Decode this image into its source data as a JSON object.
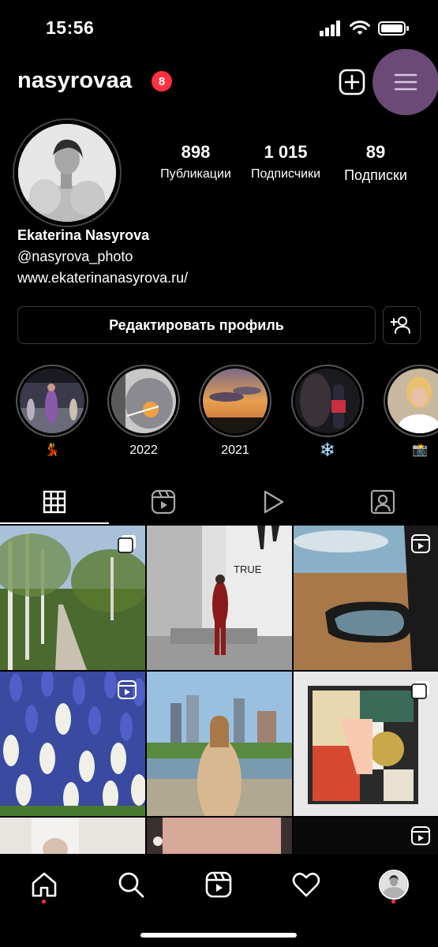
{
  "status": {
    "time": "15:56"
  },
  "header": {
    "username": "nasyrovaa",
    "badge_count": "8"
  },
  "profile": {
    "stats": [
      {
        "value": "898",
        "label": "Публикации"
      },
      {
        "value": "1 015",
        "label": "Подписчики"
      },
      {
        "value": "89",
        "label": "Подписки"
      }
    ],
    "name": "Ekaterina Nasyrova",
    "handle": "@nasyrova_photo",
    "website": "www.ekaterinanasyrova.ru/",
    "edit_button": "Редактировать профиль"
  },
  "highlights": [
    {
      "label": "💃"
    },
    {
      "label": "2022"
    },
    {
      "label": "2021"
    },
    {
      "label": "❄️"
    },
    {
      "label": "📸"
    }
  ],
  "tabs": [
    "grid-icon",
    "reels-icon",
    "play-icon",
    "tagged-icon"
  ],
  "colors": {
    "accent_badge": "#ff3040",
    "menu_highlight": "#6b4a78",
    "background": "#000000"
  }
}
